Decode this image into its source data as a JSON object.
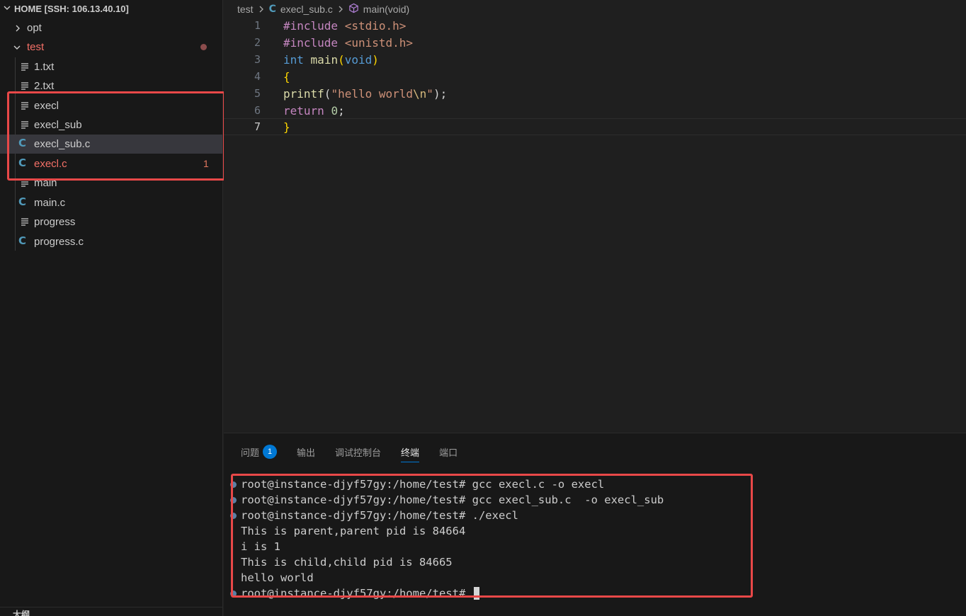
{
  "sidebar": {
    "header": "HOME [SSH: 106.13.40.10]",
    "bottom_label": "大纲",
    "items": [
      {
        "label": "opt",
        "type": "folder",
        "expanded": false
      },
      {
        "label": "test",
        "type": "folder",
        "expanded": true,
        "modified": true
      },
      {
        "label": "1.txt",
        "type": "file"
      },
      {
        "label": "2.txt",
        "type": "file"
      },
      {
        "label": "execl",
        "type": "file"
      },
      {
        "label": "execl_sub",
        "type": "file"
      },
      {
        "label": "execl_sub.c",
        "type": "c-file",
        "selected": true
      },
      {
        "label": "execl.c",
        "type": "c-file",
        "error_count": "1"
      },
      {
        "label": "main",
        "type": "file"
      },
      {
        "label": "main.c",
        "type": "c-file"
      },
      {
        "label": "progress",
        "type": "file"
      },
      {
        "label": "progress.c",
        "type": "c-file"
      }
    ]
  },
  "breadcrumb": {
    "folder": "test",
    "file_icon": "C",
    "file": "execl_sub.c",
    "symbol": "main(void)"
  },
  "editor": {
    "current_line": 7,
    "lines": [
      {
        "num": "1",
        "text": "#include <stdio.h>"
      },
      {
        "num": "2",
        "text": "#include <unistd.h>"
      },
      {
        "num": "3",
        "text": "int main(void)"
      },
      {
        "num": "4",
        "text": "{"
      },
      {
        "num": "5",
        "text": "printf(\"hello world\\n\");"
      },
      {
        "num": "6",
        "text": "return 0;"
      },
      {
        "num": "7",
        "text": "}"
      }
    ]
  },
  "panel": {
    "tabs": [
      {
        "label": "问题",
        "badge": "1"
      },
      {
        "label": "输出"
      },
      {
        "label": "调试控制台"
      },
      {
        "label": "终端",
        "active": true
      },
      {
        "label": "端口"
      }
    ],
    "terminal": [
      {
        "text": "root@instance-djyf57gy:/home/test# gcc execl.c -o execl",
        "prompt": true
      },
      {
        "text": "root@instance-djyf57gy:/home/test# gcc execl_sub.c  -o execl_sub",
        "prompt": true
      },
      {
        "text": "root@instance-djyf57gy:/home/test# ./execl",
        "prompt": true
      },
      {
        "text": "This is parent,parent pid is 84664",
        "prompt": false
      },
      {
        "text": "i is 1",
        "prompt": false
      },
      {
        "text": "This is child,child pid is 84665",
        "prompt": false
      },
      {
        "text": "hello world",
        "prompt": false
      },
      {
        "text": "root@instance-djyf57gy:/home/test# ",
        "prompt": true
      }
    ]
  },
  "colors": {
    "highlight_box": "#e84848",
    "c_icon": "#519aba",
    "error_text": "#f47067",
    "badge": "#0078d4"
  }
}
